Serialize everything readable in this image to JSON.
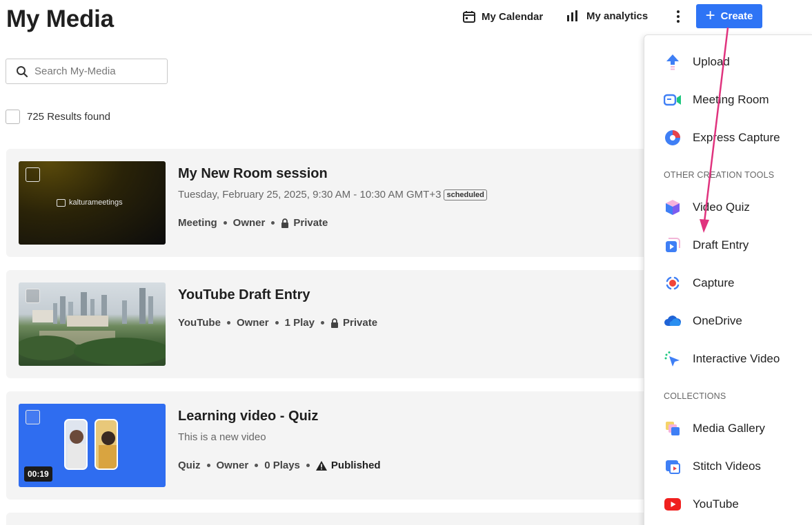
{
  "page": {
    "title": "My Media"
  },
  "nav": {
    "calendar": "My Calendar",
    "analytics": "My analytics",
    "create": "Create"
  },
  "search": {
    "placeholder": "Search My-Media"
  },
  "results": {
    "label": "725 Results found"
  },
  "entries": [
    {
      "title": "My New Room session",
      "subtitle": "Tuesday, February 25, 2025, 9:30 AM - 10:30 AM GMT+3",
      "badge": "scheduled",
      "meta": [
        "Meeting",
        "Owner",
        "Private"
      ],
      "thumb_logo": "kalturameetings"
    },
    {
      "title": "YouTube Draft Entry",
      "meta": [
        "YouTube",
        "Owner",
        "1 Play",
        "Private"
      ]
    },
    {
      "title": "Learning video - Quiz",
      "subtitle": "This is a new video",
      "meta": [
        "Quiz",
        "Owner",
        "0 Plays",
        "Published"
      ],
      "duration": "00:19"
    }
  ],
  "menu": {
    "items_top": [
      "Upload",
      "Meeting Room",
      "Express Capture"
    ],
    "section_other": "OTHER CREATION TOOLS",
    "items_other": [
      "Video Quiz",
      "Draft Entry",
      "Capture",
      "OneDrive",
      "Interactive Video"
    ],
    "section_collections": "COLLECTIONS",
    "items_collections": [
      "Media Gallery",
      "Stitch Videos",
      "YouTube"
    ]
  },
  "colors": {
    "accent": "#2e74f5",
    "annotation_arrow": "#e0337e"
  }
}
